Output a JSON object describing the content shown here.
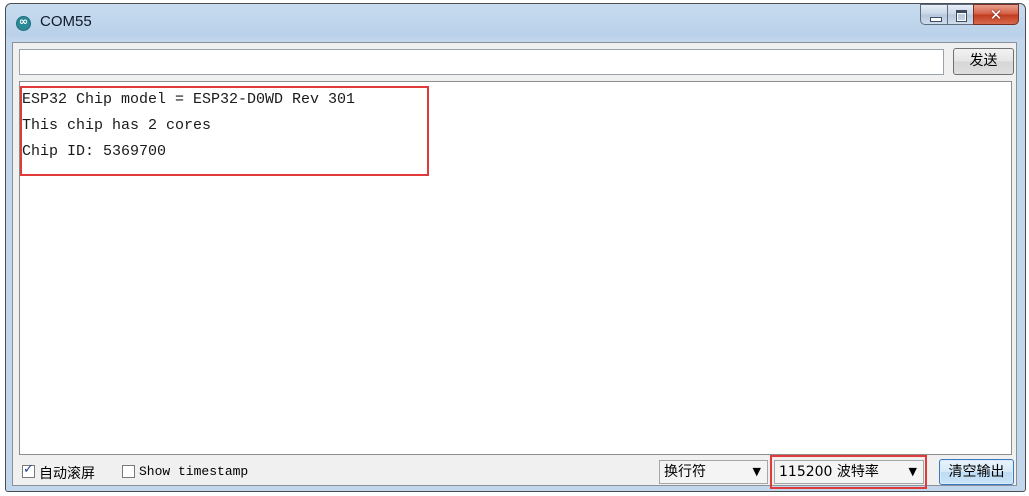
{
  "window": {
    "title": "COM55"
  },
  "send": {
    "input_value": "",
    "button_label": "发送"
  },
  "output": {
    "lines": [
      "ESP32 Chip model = ESP32-D0WD Rev 301",
      "This chip has 2 cores",
      "Chip ID: 5369700"
    ]
  },
  "bottom": {
    "autoscroll": {
      "label": "自动滚屏",
      "checked": true
    },
    "timestamp": {
      "label": "Show timestamp",
      "checked": false
    },
    "line_ending": "换行符",
    "baud_rate": "115200 波特率",
    "clear_button": "清空输出"
  },
  "colors": {
    "highlight": "#e03a3a",
    "titlebar": "#b9d1ea",
    "close_button": "#c7442a"
  }
}
